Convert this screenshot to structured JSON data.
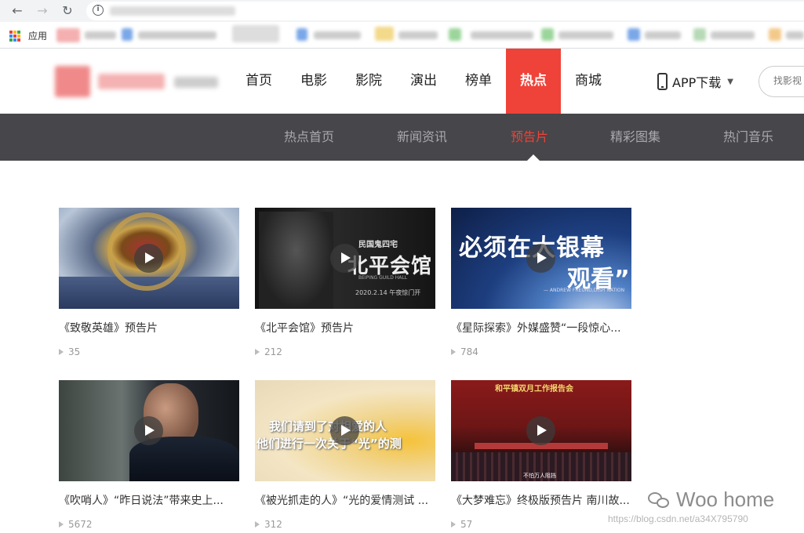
{
  "browser": {
    "apps_label": "应用"
  },
  "header": {
    "nav": [
      "首页",
      "电影",
      "影院",
      "演出",
      "榜单",
      "热点",
      "商城"
    ],
    "active_nav": "热点",
    "app_download": "APP下载",
    "search_placeholder": "找影视"
  },
  "sub_nav": {
    "items": [
      "热点首页",
      "新闻资讯",
      "预告片",
      "精彩图集",
      "热门音乐"
    ],
    "active": "预告片"
  },
  "videos": [
    {
      "title": "《致敬英雄》预告片",
      "views": "35"
    },
    {
      "title": "《北平会馆》预告片",
      "views": "212"
    },
    {
      "title": "《星际探索》外媒盛赞“一段惊心...",
      "views": "784"
    },
    {
      "title": "《吹哨人》“昨日说法”带来史上...",
      "views": "5672"
    },
    {
      "title": "《被光抓走的人》“光的爱情测试 ...",
      "views": "312"
    },
    {
      "title": "《大梦难忘》终极版预告片 南川故...",
      "views": "57"
    }
  ],
  "thumb_text": {
    "v2_top": "民国鬼四宅",
    "v2_big": "北平会馆",
    "v2_en": "BEIPING GUILD HALL",
    "v2_date": "2020.2.14 午夜惊门开",
    "v3_line1": "必须在大银幕",
    "v3_line2": "观看”",
    "v3_credit": "— ANDREW FREUND,DISH NATION",
    "v5_line1": "我们请到了对相爱的人",
    "v5_line2": "他们进行一次关于“光”的测",
    "v6_banner": "和平镇双月工作报告会",
    "v6_sub": "不怕万人阻挡"
  },
  "watermark": {
    "brand": "Woo home",
    "url": "https://blog.csdn.net/a34X795790"
  }
}
